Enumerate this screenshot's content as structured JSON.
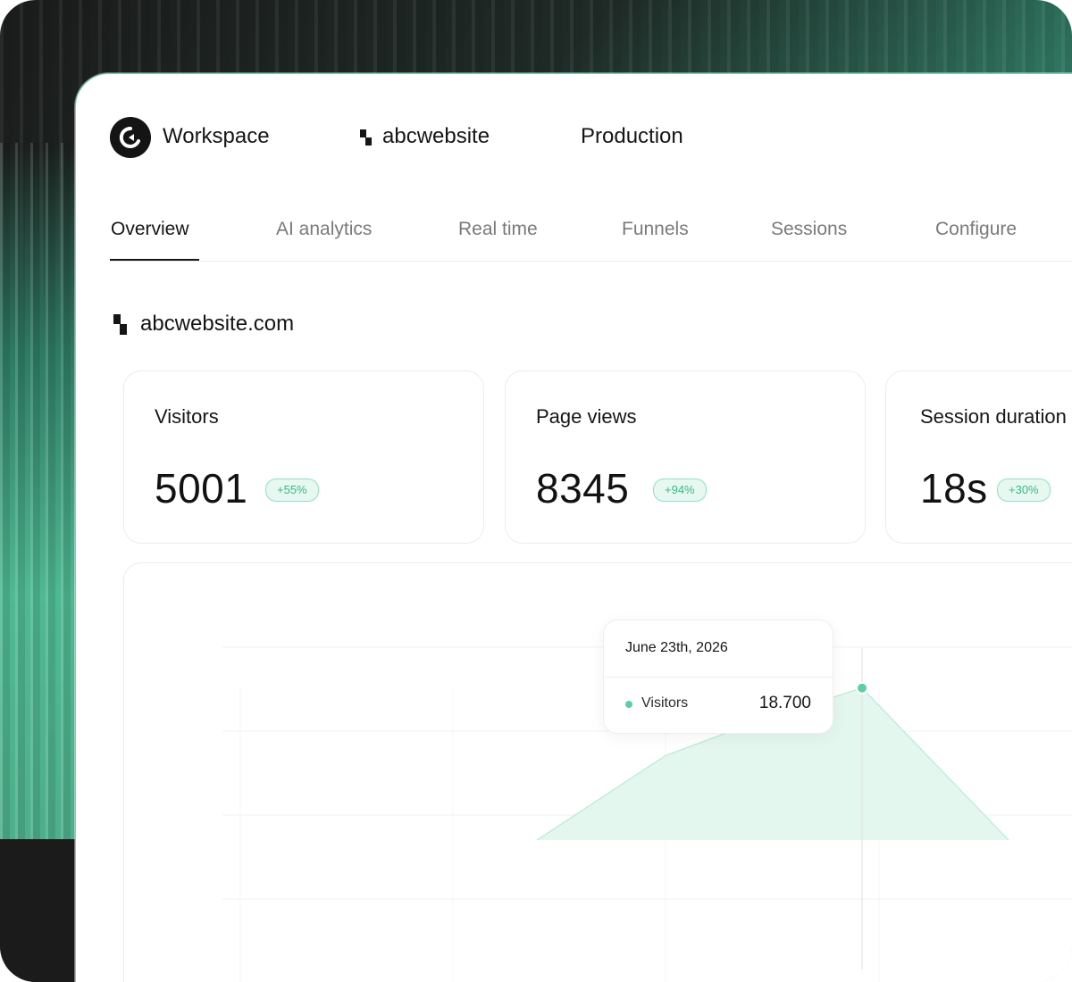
{
  "header": {
    "workspace_label": "Workspace",
    "project_label": "abcwebsite",
    "environment_label": "Production"
  },
  "tabs": [
    {
      "label": "Overview",
      "active": true
    },
    {
      "label": "AI analytics",
      "active": false
    },
    {
      "label": "Real time",
      "active": false
    },
    {
      "label": "Funnels",
      "active": false
    },
    {
      "label": "Sessions",
      "active": false
    },
    {
      "label": "Configure",
      "active": false
    }
  ],
  "site": {
    "domain": "abcwebsite.com"
  },
  "metrics": [
    {
      "label": "Visitors",
      "value": "5001",
      "change": "+55%"
    },
    {
      "label": "Page views",
      "value": "8345",
      "change": "+94%"
    },
    {
      "label": "Session duration",
      "value": "18s",
      "change": "+30%"
    }
  ],
  "tooltip": {
    "date": "June 23th, 2026",
    "series_label": "Visitors",
    "series_value": "18.700"
  },
  "colors": {
    "accent": "#5ccfa5",
    "accent_fill": "#e3f7ef",
    "text_primary": "#151515",
    "text_muted": "#7a7a7a"
  },
  "chart_data": {
    "type": "area",
    "series": [
      {
        "name": "Visitors",
        "values": [
          0,
          0.55,
          0.78,
          0.99,
          0
        ]
      }
    ],
    "highlight_index": 3,
    "grid": true
  }
}
